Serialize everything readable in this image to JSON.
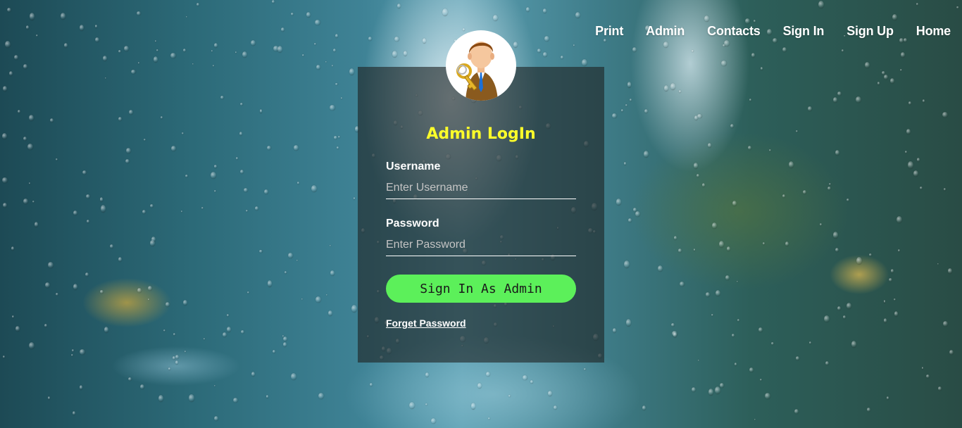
{
  "nav": {
    "items": [
      "Print",
      "Admin",
      "Contacts",
      "Sign In",
      "Sign Up",
      "Home"
    ]
  },
  "login": {
    "title": "Admin LogIn",
    "username_label": "Username",
    "username_placeholder": "Enter Username",
    "username_value": "",
    "password_label": "Password",
    "password_placeholder": "Enter Password",
    "password_value": "",
    "submit_label": "Sign In As Admin",
    "forget_label": "Forget Password"
  },
  "icons": {
    "avatar": "admin-key-avatar-icon"
  },
  "colors": {
    "title": "#ffff2a",
    "button": "#5cf05a",
    "card": "rgba(30,35,35,0.62)"
  }
}
